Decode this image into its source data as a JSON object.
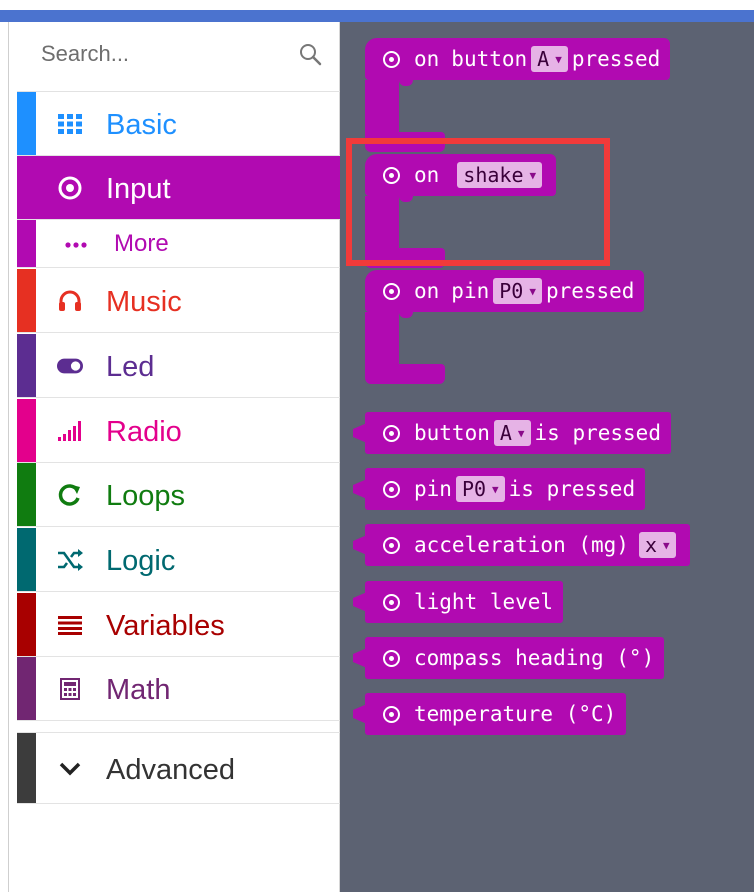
{
  "colors": {
    "input_accent": "#b10ab1",
    "workspace_bg": "#5c6272",
    "highlight": "#f23a3a"
  },
  "search": {
    "placeholder": "Search...",
    "icon": "magnifier-icon"
  },
  "categories": [
    {
      "label": "Basic",
      "icon": "grid-icon",
      "color": "#1e90ff"
    },
    {
      "label": "Input",
      "icon": "target-icon",
      "color": "#b10ab1",
      "selected": true
    },
    {
      "label": "More",
      "icon": "dots-icon",
      "color": "#b10ab1",
      "sub": true
    },
    {
      "label": "Music",
      "icon": "headphones-icon",
      "color": "#e63022"
    },
    {
      "label": "Led",
      "icon": "toggle-icon",
      "color": "#5c2d91"
    },
    {
      "label": "Radio",
      "icon": "signal-bars-icon",
      "color": "#e3008c"
    },
    {
      "label": "Loops",
      "icon": "refresh-icon",
      "color": "#107c10"
    },
    {
      "label": "Logic",
      "icon": "shuffle-icon",
      "color": "#006970"
    },
    {
      "label": "Variables",
      "icon": "list-icon",
      "color": "#a80000"
    },
    {
      "label": "Math",
      "icon": "calculator-icon",
      "color": "#712672"
    }
  ],
  "advanced": {
    "label": "Advanced",
    "icon": "chevron-down-icon"
  },
  "blocks": {
    "on_button": {
      "on": "on",
      "button": "button",
      "value": "A",
      "pressed": "pressed"
    },
    "on_shake": {
      "on": "on",
      "value": "shake"
    },
    "on_pin": {
      "on": "on",
      "pin": "pin",
      "value": "P0",
      "pressed": "pressed"
    },
    "button_is_pressed": {
      "button": "button",
      "value": "A",
      "is_pressed": "is pressed"
    },
    "pin_is_pressed": {
      "pin": "pin",
      "value": "P0",
      "is_pressed": "is pressed"
    },
    "acceleration": {
      "label": "acceleration (mg)",
      "value": "x"
    },
    "light_level": {
      "label": "light level"
    },
    "compass_heading": {
      "label": "compass heading (°)"
    },
    "temperature": {
      "label": "temperature (°C)"
    }
  }
}
